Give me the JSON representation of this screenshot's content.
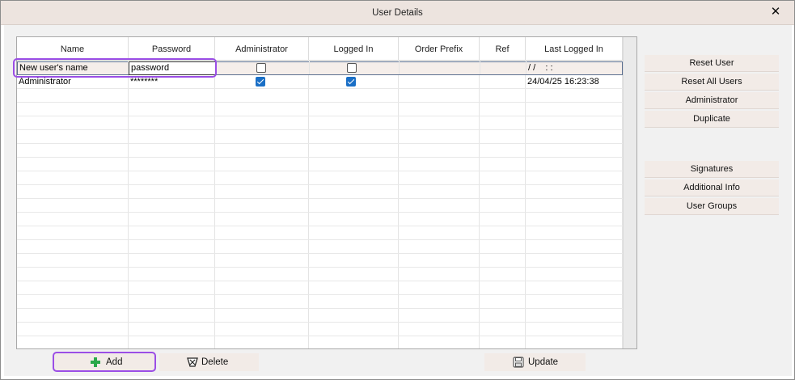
{
  "window": {
    "title": "User Details",
    "close_symbol": "✕"
  },
  "grid": {
    "columns": [
      "Name",
      "Password",
      "Administrator",
      "Logged In",
      "Order Prefix",
      "Ref",
      "Last Logged In"
    ],
    "new_row": {
      "name": "New user's name",
      "password": "password",
      "administrator": false,
      "logged_in": false,
      "order_prefix": "",
      "ref": "",
      "last_logged_in": "/ /    : :"
    },
    "rows": [
      {
        "name": "Administrator",
        "password": "********",
        "administrator": true,
        "logged_in": true,
        "order_prefix": "",
        "ref": "",
        "last_logged_in": "24/04/25 16:23:38"
      }
    ]
  },
  "side_buttons": {
    "reset_user": "Reset User",
    "reset_all_users": "Reset All Users",
    "administrator": "Administrator",
    "duplicate": "Duplicate",
    "signatures": "Signatures",
    "additional_info": "Additional Info",
    "user_groups": "User Groups"
  },
  "bottom_buttons": {
    "add": "Add",
    "delete": "Delete",
    "update": "Update"
  },
  "icons": {
    "add": "plus-icon",
    "delete": "trash-icon",
    "update": "save-icon"
  },
  "colors": {
    "checkbox_checked": "#1a6fc6",
    "highlight": "#9b4ee6",
    "add_icon": "#2aa84a"
  }
}
